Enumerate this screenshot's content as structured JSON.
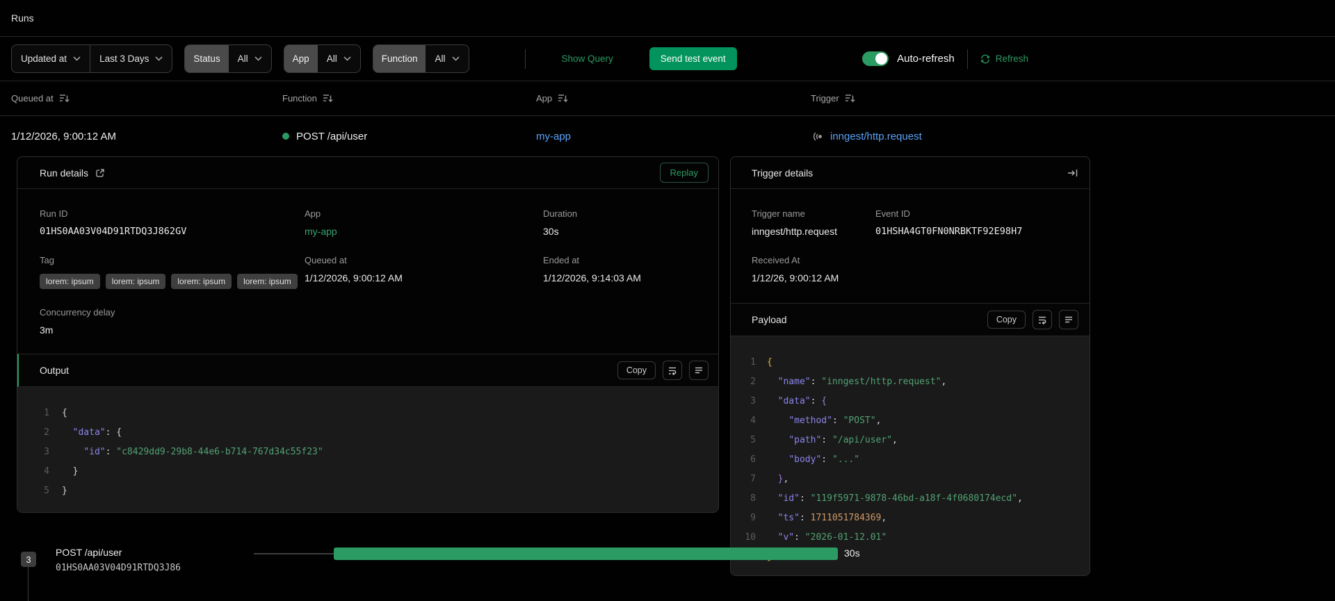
{
  "page": {
    "title": "Runs"
  },
  "colors": {
    "accent_green": "#2c9b63",
    "button_green": "#02945c",
    "link_blue": "#5aa2f7",
    "status_dot": "#2c9b63",
    "code_key": "#8c85ec",
    "code_string": "#52a273",
    "code_number": "#d19a66"
  },
  "filters": {
    "sort_field": {
      "label": "Updated at"
    },
    "time_range": {
      "label": "Last 3 Days"
    },
    "status": {
      "label": "Status",
      "value": "All"
    },
    "app": {
      "label": "App",
      "value": "All"
    },
    "function": {
      "label": "Function",
      "value": "All"
    },
    "show_query_label": "Show Query",
    "send_test_event_label": "Send test event",
    "auto_refresh_label": "Auto-refresh",
    "auto_refresh_on": true,
    "refresh_label": "Refresh"
  },
  "table": {
    "columns": [
      {
        "label": "Queued at"
      },
      {
        "label": "Function"
      },
      {
        "label": "App"
      },
      {
        "label": "Trigger"
      }
    ],
    "row": {
      "queued_at": "1/12/2026, 9:00:12 AM",
      "function": "POST /api/user",
      "app": "my-app",
      "trigger": "inngest/http.request"
    }
  },
  "run_details": {
    "title": "Run details",
    "replay_label": "Replay",
    "fields": {
      "run_id": {
        "label": "Run ID",
        "value": "01HS0AA03V04D91RTDQ3J862GV"
      },
      "app": {
        "label": "App",
        "value": "my-app"
      },
      "duration": {
        "label": "Duration",
        "value": "30s"
      },
      "tag": {
        "label": "Tag",
        "values": [
          "lorem: ipsum",
          "lorem: ipsum",
          "lorem: ipsum",
          "lorem: ipsum"
        ]
      },
      "queued_at": {
        "label": "Queued at",
        "value": "1/12/2026, 9:00:12 AM"
      },
      "ended_at": {
        "label": "Ended at",
        "value": "1/12/2026, 9:14:03 AM"
      },
      "concurrency_delay": {
        "label": "Concurrency delay",
        "value": "3m"
      }
    },
    "output": {
      "title": "Output",
      "copy_label": "Copy",
      "code": [
        [
          [
            "p",
            "{"
          ]
        ],
        [
          [
            "p",
            "  "
          ],
          [
            "k",
            "\"data\""
          ],
          [
            "p",
            ": {"
          ]
        ],
        [
          [
            "p",
            "    "
          ],
          [
            "k",
            "\"id\""
          ],
          [
            "p",
            ": "
          ],
          [
            "s",
            "\"c8429dd9-29b8-44e6-b714-767d34c55f23\""
          ]
        ],
        [
          [
            "p",
            "  }"
          ]
        ],
        [
          [
            "p",
            "}"
          ]
        ]
      ]
    }
  },
  "trigger_details": {
    "title": "Trigger details",
    "fields": {
      "trigger_name": {
        "label": "Trigger name",
        "value": "inngest/http.request"
      },
      "event_id": {
        "label": "Event ID",
        "value": "01HSHA4GT0FN0NRBKTF92E98H7"
      },
      "received_at": {
        "label": "Received At",
        "value": "1/12/26, 9:00:12 AM"
      }
    },
    "payload": {
      "title": "Payload",
      "copy_label": "Copy",
      "code": [
        [
          [
            "y",
            "{"
          ]
        ],
        [
          [
            "p",
            "  "
          ],
          [
            "k",
            "\"name\""
          ],
          [
            "p",
            ": "
          ],
          [
            "s",
            "\"inngest/http.request\""
          ],
          [
            "p",
            ","
          ]
        ],
        [
          [
            "p",
            "  "
          ],
          [
            "k",
            "\"data\""
          ],
          [
            "p",
            ": "
          ],
          [
            "b",
            "{"
          ]
        ],
        [
          [
            "p",
            "    "
          ],
          [
            "k",
            "\"method\""
          ],
          [
            "p",
            ": "
          ],
          [
            "s",
            "\"POST\""
          ],
          [
            "p",
            ","
          ]
        ],
        [
          [
            "p",
            "    "
          ],
          [
            "k",
            "\"path\""
          ],
          [
            "p",
            ": "
          ],
          [
            "s",
            "\"/api/user\""
          ],
          [
            "p",
            ","
          ]
        ],
        [
          [
            "p",
            "    "
          ],
          [
            "k",
            "\"body\""
          ],
          [
            "p",
            ": "
          ],
          [
            "s",
            "\"...\""
          ]
        ],
        [
          [
            "p",
            "  "
          ],
          [
            "b",
            "}"
          ],
          [
            "p",
            ","
          ]
        ],
        [
          [
            "p",
            "  "
          ],
          [
            "k",
            "\"id\""
          ],
          [
            "p",
            ": "
          ],
          [
            "s",
            "\"119f5971-9878-46bd-a18f-4f0680174ecd\""
          ],
          [
            "p",
            ","
          ]
        ],
        [
          [
            "p",
            "  "
          ],
          [
            "k",
            "\"ts\""
          ],
          [
            "p",
            ": "
          ],
          [
            "n",
            "1711051784369"
          ],
          [
            "p",
            ","
          ]
        ],
        [
          [
            "p",
            "  "
          ],
          [
            "k",
            "\"v\""
          ],
          [
            "p",
            ": "
          ],
          [
            "s",
            "\"2026-01-12.01\""
          ]
        ],
        [
          [
            "y",
            "}"
          ]
        ]
      ]
    }
  },
  "timeline": {
    "step_count": "3",
    "function": "POST /api/user",
    "run_id": "01HS0AA03V04D91RTDQ3J86",
    "duration": "30s"
  }
}
